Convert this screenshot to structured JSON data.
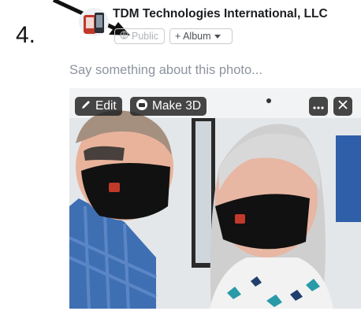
{
  "step_number": "4.",
  "post": {
    "page_name": "TDM Technologies International, LLC",
    "privacy_label": "Public",
    "album_label": "+ Album",
    "caption_placeholder": "Say something about this photo..."
  },
  "photo_toolbar": {
    "edit_label": "Edit",
    "make3d_label": "Make 3D"
  },
  "icons": [
    "pencil-icon",
    "3d-icon",
    "more-icon",
    "close-icon",
    "globe-icon",
    "chevron-down-icon"
  ],
  "colors": {
    "text": "#1c1e21",
    "muted": "#8d949e",
    "mask": "#111111",
    "shirt": "#3f6fb3"
  }
}
